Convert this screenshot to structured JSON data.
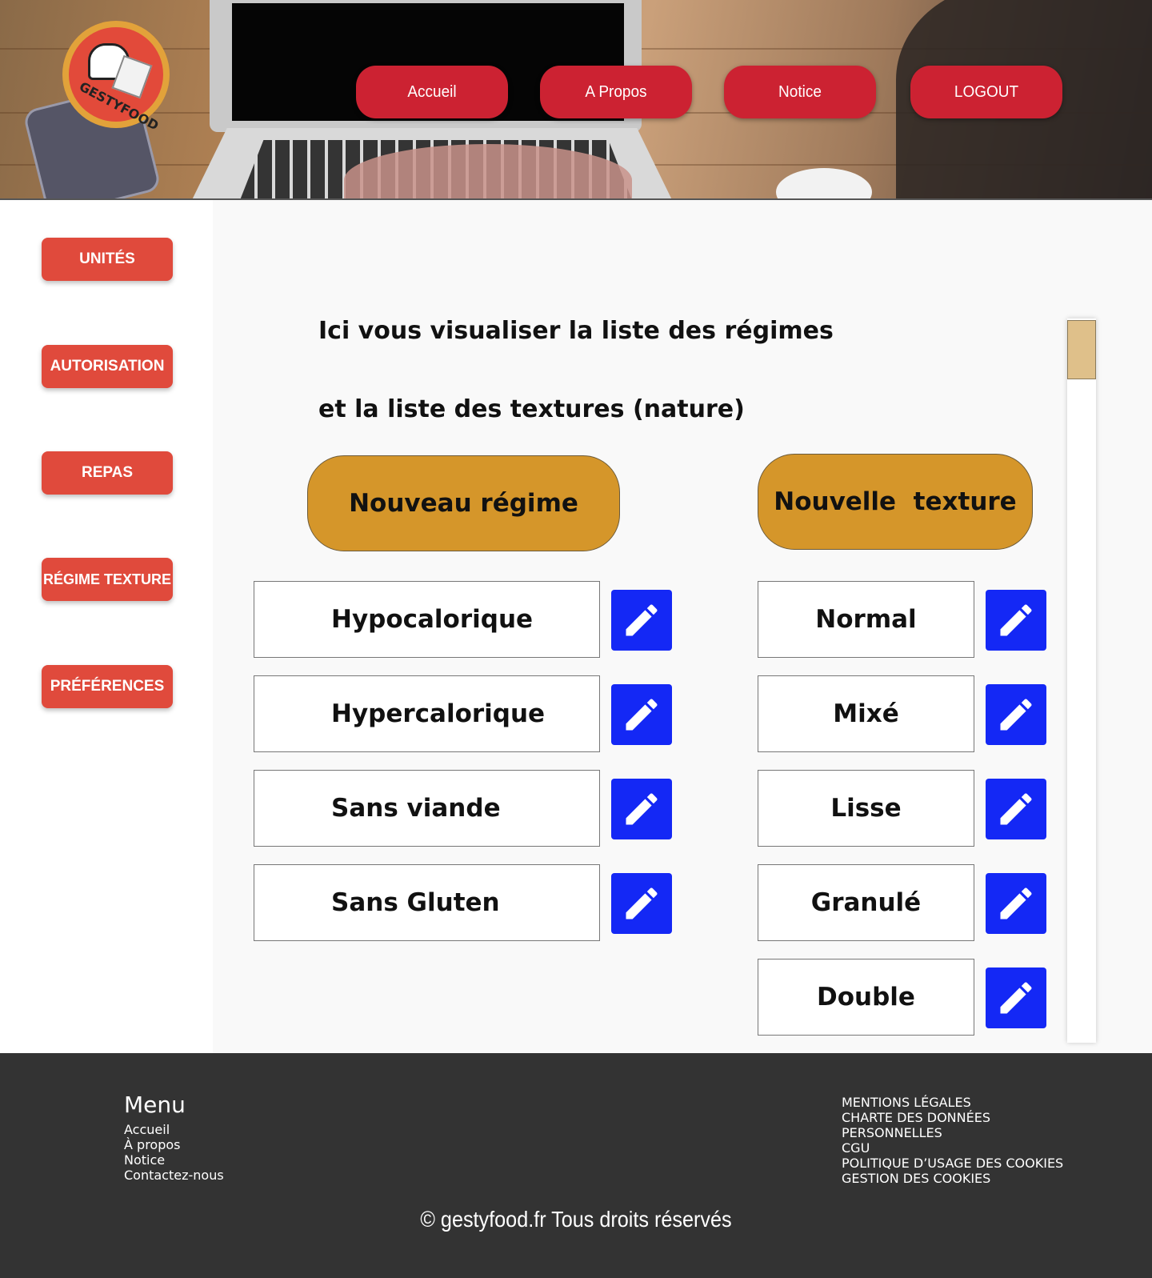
{
  "header": {
    "logo_text": "GESTYFOOD",
    "nav": [
      "Accueil",
      "A Propos",
      "Notice",
      "LOGOUT"
    ]
  },
  "sidebar": {
    "items": [
      "UNITÉS",
      "AUTORISATION",
      "REPAS",
      "RÉGIME TEXTURE",
      "PRÉFÉRENCES"
    ]
  },
  "main": {
    "intro_line1": "Ici vous  visualiser  la liste des régimes",
    "intro_line2": "et la liste des textures (nature)",
    "new_regime_label": "Nouveau régime",
    "new_texture_label": "Nouvelle  texture",
    "regimes": [
      "Hypocalorique",
      "Hypercalorique",
      "Sans viande",
      "Sans Gluten"
    ],
    "textures": [
      "Normal",
      "Mixé",
      "Lisse",
      "Granulé",
      "Double"
    ]
  },
  "footer": {
    "menu_title": "Menu",
    "menu_items": [
      "Accueil",
      "À propos",
      "Notice",
      "Contactez-nous"
    ],
    "legal_items": [
      "MENTIONS LÉGALES",
      "CHARTE DES DONNÉES",
      "PERSONNELLES",
      "CGU",
      "POLITIQUE D’USAGE DES COOKIES",
      "GESTION DES COOKIES"
    ],
    "copyright": "© gestyfood.fr  Tous droits réservés"
  },
  "colors": {
    "nav_red": "#cc2232",
    "sidebar_red": "#e04a3c",
    "accent_gold": "#d5962a",
    "edit_blue": "#1428f5",
    "footer_dark": "#333333"
  },
  "icons": {
    "edit": "pencil-icon"
  }
}
